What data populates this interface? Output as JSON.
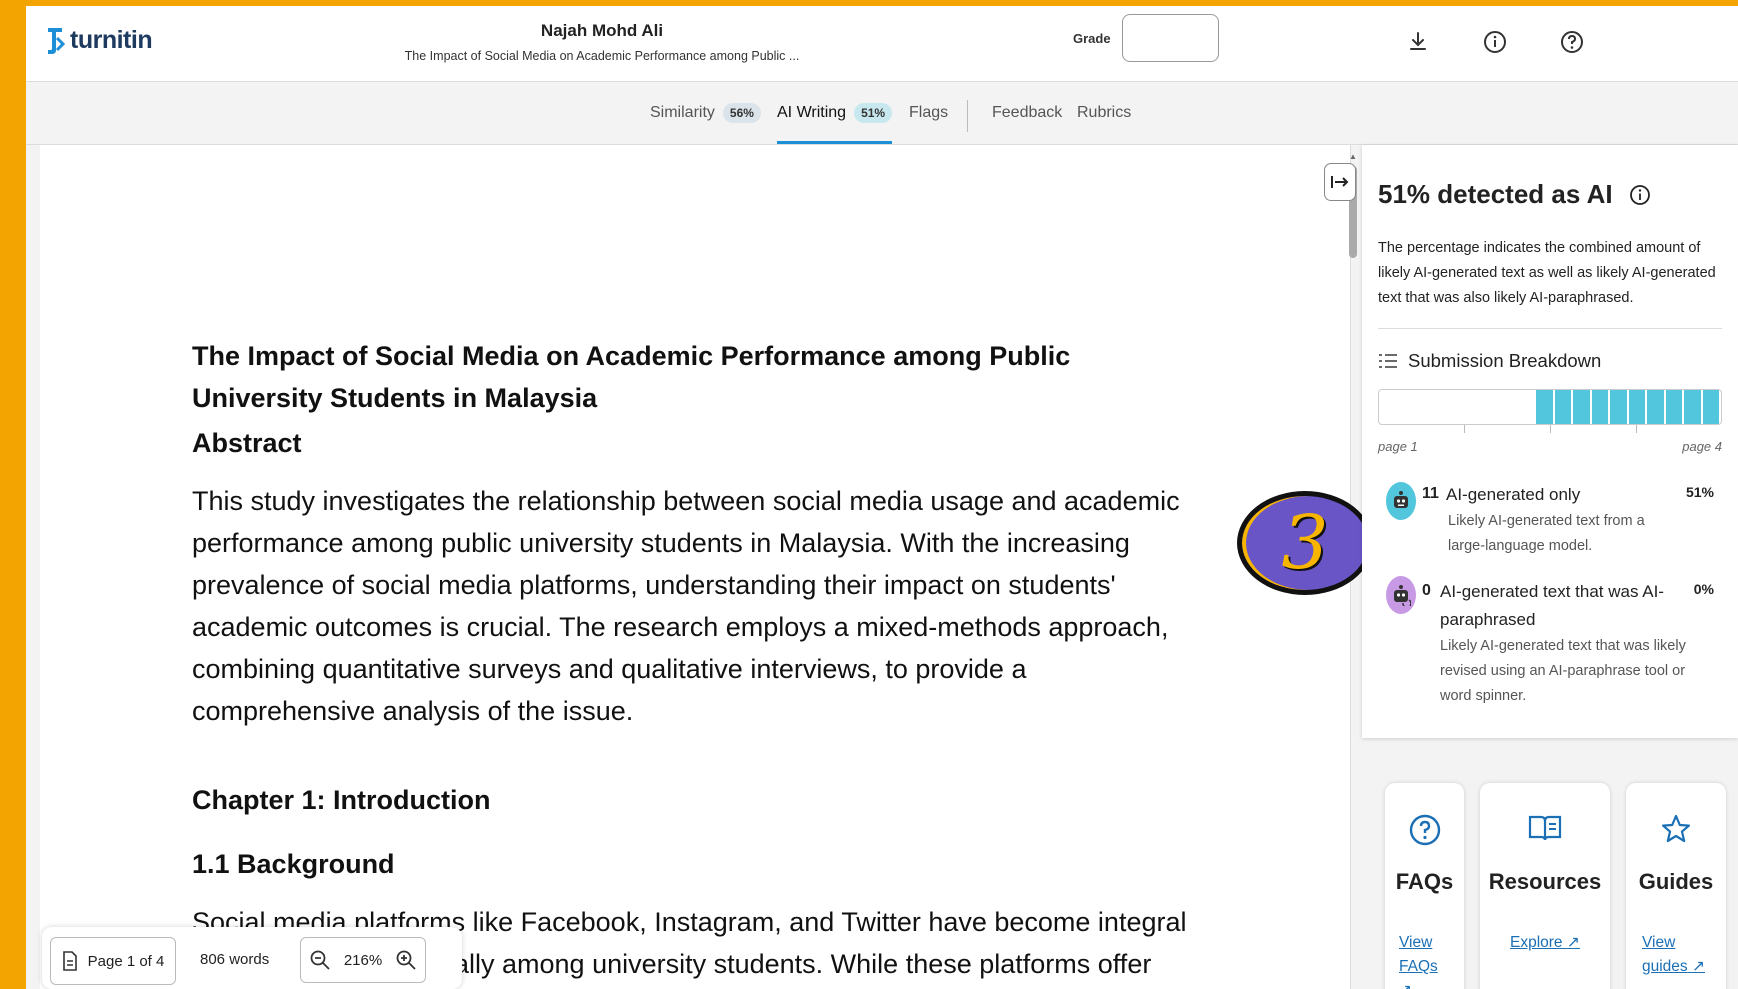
{
  "header": {
    "logo_text": "turnitin",
    "author": "Najah Mohd Ali",
    "doc_title": "The Impact of Social Media on Academic Performance among Public ...",
    "grade_label": "Grade",
    "grade_value": "",
    "icons": [
      "download-icon",
      "info-icon",
      "help-icon"
    ]
  },
  "tabs": [
    {
      "label": "Similarity",
      "badge": "56%"
    },
    {
      "label": "AI Writing",
      "badge": "51%",
      "active": true
    },
    {
      "label": "Flags"
    },
    {
      "label": "Feedback"
    },
    {
      "label": "Rubrics"
    }
  ],
  "document": {
    "title": "The Impact of Social Media on Academic Performance among Public University Students in Malaysia",
    "abstract_heading": "Abstract",
    "abstract_text": "This study investigates the relationship between social media usage and academic performance among public university students in Malaysia. With the increasing prevalence of social media platforms, understanding their impact on students' academic outcomes is crucial. The research employs a mixed-methods approach, combining quantitative surveys and qualitative interviews, to provide a comprehensive analysis of the issue.",
    "chapter_heading": "Chapter 1: Introduction",
    "section_heading": "1.1 Background",
    "body_line1": "Social media platforms like Facebook, Instagram, and Twitter have become integral",
    "body_line2": "ally among university students. While these platforms offer"
  },
  "toolbar": {
    "page_label": "Page 1 of 4",
    "words": "806 words",
    "zoom": "216%"
  },
  "callout": {
    "number": "3"
  },
  "ai_panel": {
    "title": "51% detected as AI",
    "description": "The percentage indicates the combined amount of likely AI-generated text as well as likely AI-generated text that was also likely AI-paraphrased.",
    "breakdown_title": "Submission Breakdown",
    "breakdown_fill_fraction": 0.54,
    "page_start": "page 1",
    "page_end": "page 4",
    "colors": {
      "ai_generated": "#52c6dc",
      "ai_paraphrased": "#b07ed8"
    },
    "rows": [
      {
        "count": "11",
        "label": "AI-generated only",
        "desc": "Likely AI-generated text from a large-language model.",
        "pct": "51%"
      },
      {
        "count": "0",
        "label": "AI-generated text that was AI-paraphrased",
        "desc": "Likely AI-generated text that was likely revised using an AI-paraphrase tool or word spinner.",
        "pct": "0%"
      }
    ]
  },
  "cards": [
    {
      "title": "FAQs",
      "link": "View FAQs"
    },
    {
      "title": "Resources",
      "link": "Explore"
    },
    {
      "title": "Guides",
      "link": "View guides"
    }
  ]
}
